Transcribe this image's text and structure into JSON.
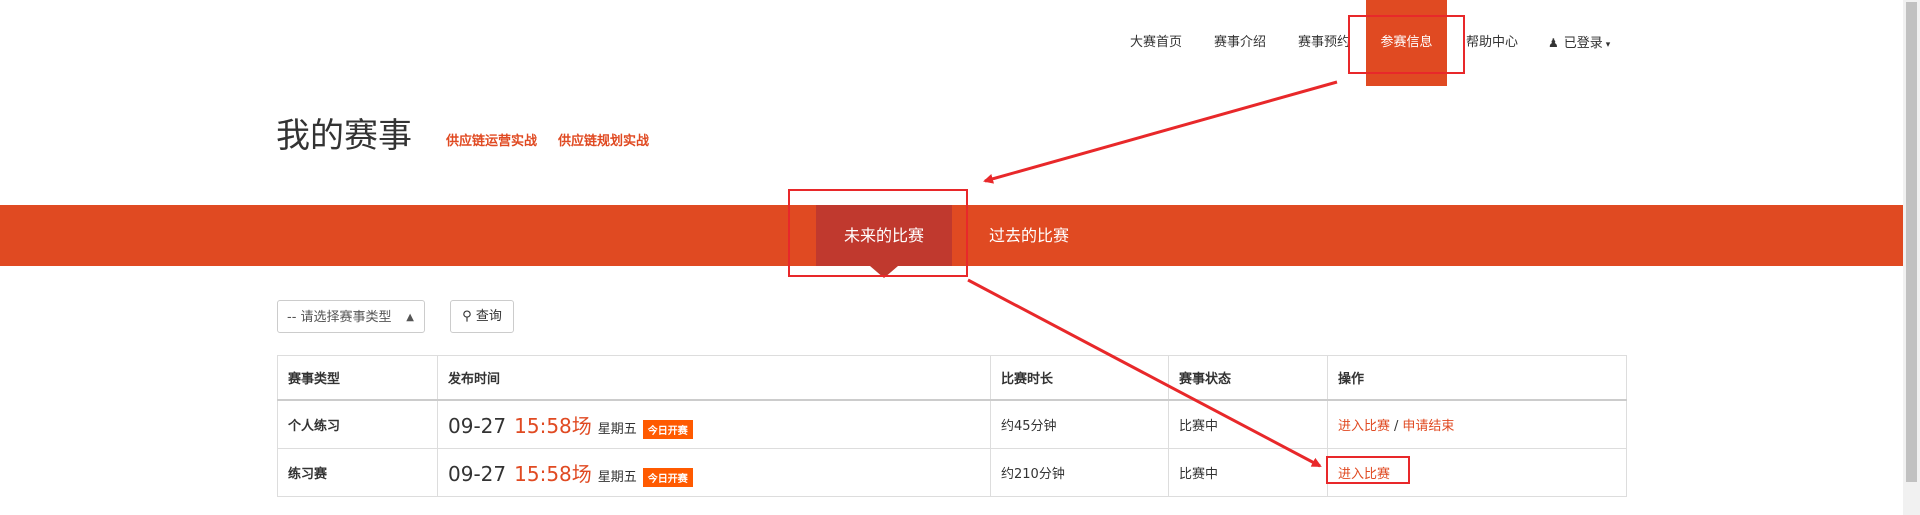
{
  "nav": {
    "items": [
      {
        "label": "大赛首页"
      },
      {
        "label": "赛事介绍"
      },
      {
        "label": "赛事预约"
      },
      {
        "label": "参赛信息"
      },
      {
        "label": "帮助中心"
      }
    ],
    "user_label": "已登录"
  },
  "page": {
    "title": "我的赛事",
    "categories": [
      "供应链运营实战",
      "供应链规划实战"
    ]
  },
  "tabs": [
    {
      "label": "未来的比赛"
    },
    {
      "label": "过去的比赛"
    }
  ],
  "filter": {
    "select_value": "-- 请选择赛事类型",
    "query_label": "查询"
  },
  "table": {
    "headers": [
      "赛事类型",
      "发布时间",
      "比赛时长",
      "赛事状态",
      "操作"
    ],
    "rows": [
      {
        "type": "个人练习",
        "date": "09-27",
        "time": "15:58场",
        "weekday": "星期五",
        "badge": "今日开赛",
        "duration": "约45分钟",
        "status": "比赛中",
        "action1": "进入比赛",
        "action_sep": "/",
        "action2": "申请结束"
      },
      {
        "type": "练习赛",
        "date": "09-27",
        "time": "15:58场",
        "weekday": "星期五",
        "badge": "今日开赛",
        "duration": "约210分钟",
        "status": "比赛中",
        "action1": "进入比赛"
      }
    ]
  },
  "annotation_color": "#e8282a",
  "accent_color": "#e04a22"
}
